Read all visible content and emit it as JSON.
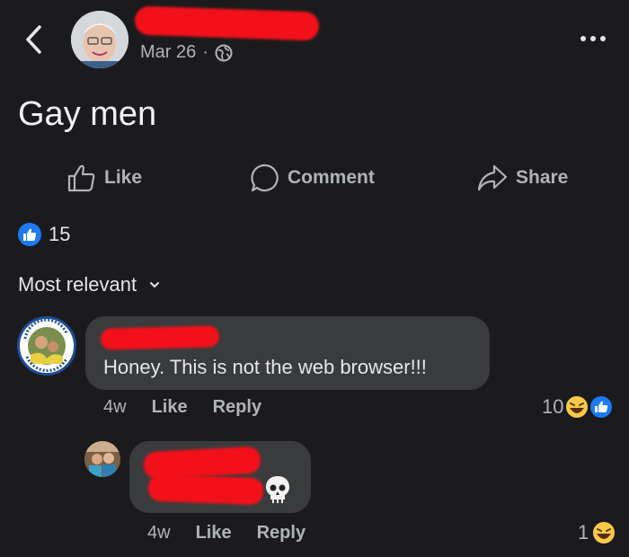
{
  "post": {
    "date": "Mar 26",
    "separator": "·",
    "audience_icon": "globe-icon",
    "text": "Gay men"
  },
  "actions": {
    "like_label": "Like",
    "comment_label": "Comment",
    "share_label": "Share"
  },
  "reactions": {
    "icon": "thumbs-up-icon",
    "count": "15"
  },
  "sort": {
    "label": "Most relevant",
    "icon": "chevron-down-icon"
  },
  "comments": [
    {
      "text": "Honey. This is not the web browser!!!",
      "age": "4w",
      "like_label": "Like",
      "reply_label": "Reply",
      "reaction_count": "10",
      "reaction_icons": [
        "laughing-emoji-icon",
        "thumbs-up-icon"
      ]
    },
    {
      "text": "💀",
      "age": "4w",
      "like_label": "Like",
      "reply_label": "Reply",
      "reaction_count": "1",
      "reaction_icons": [
        "laughing-emoji-icon"
      ]
    }
  ],
  "colors": {
    "background": "#1b1b1d",
    "bubble": "#3a3b3c",
    "accent_blue": "#1d7af2",
    "redaction": "#f2101a"
  }
}
